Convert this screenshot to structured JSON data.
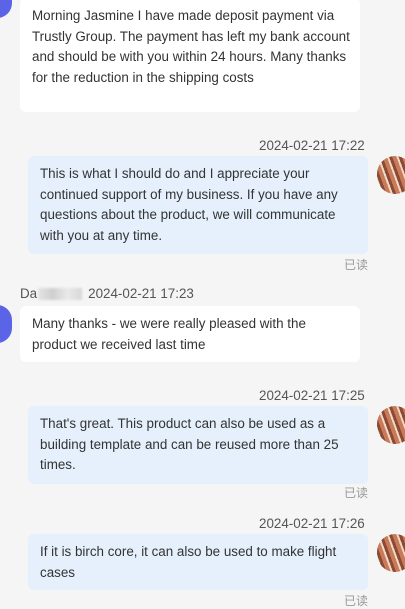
{
  "messages": [
    {
      "text": "Morning Jasmine I have made deposit payment via Trustly Group. The payment has left my bank account and should be with you within 24 hours. Many thanks for the reduction in the shipping costs"
    },
    {
      "time": "2024-02-21 17:22",
      "text": "This is what I should do and I appreciate your continued support of my business. If you have any questions about the product, we will communicate with you at any time.",
      "status": "已读"
    },
    {
      "sender": "Da",
      "time": "2024-02-21 17:23",
      "text": "Many thanks - we were really pleased with the product we received last time"
    },
    {
      "time": "2024-02-21 17:25",
      "text": "That's great. This product can also be used as a building template and can be reused more than 25 times.",
      "status": "已读"
    },
    {
      "time": "2024-02-21 17:26",
      "text": "If it is birch core, it can also be used to make flight cases",
      "status": "已读"
    }
  ]
}
